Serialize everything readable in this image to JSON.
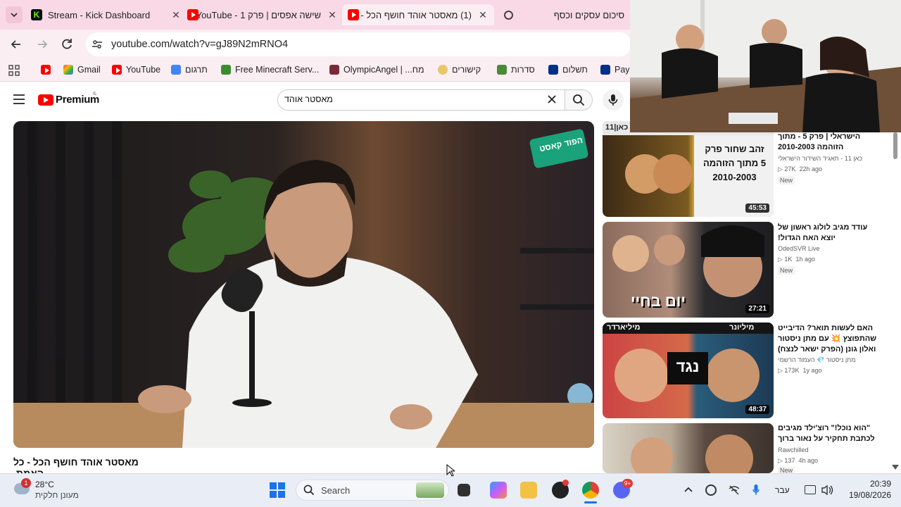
{
  "tabs": [
    {
      "title": "Stream - Kick Dashboard",
      "favicon": "kick-icon"
    },
    {
      "title": "שישה אפסים | פרק 1 - YouTube",
      "favicon": "youtube-icon"
    },
    {
      "title": "(1) מאסטר אוהד חושף הכל -",
      "favicon": "youtube-icon",
      "active": true
    },
    {
      "title": "סיכום עסקים וכסף",
      "favicon": "chatgpt-icon"
    }
  ],
  "address": {
    "url": "youtube.com/watch?v=gJ89N2mRNO4"
  },
  "bookmarks": [
    {
      "label": "",
      "icon": "youtube-icon"
    },
    {
      "label": "Gmail",
      "icon": "gmail-icon"
    },
    {
      "label": "YouTube",
      "icon": "youtube-icon"
    },
    {
      "label": "תרגום",
      "icon": "translate-icon"
    },
    {
      "label": "Free Minecraft Serv...",
      "icon": "minecraft-icon"
    },
    {
      "label": "OlympicAngel | ...מח",
      "icon": "bookmark-icon"
    },
    {
      "label": "קישורים",
      "icon": "bookmark-icon"
    },
    {
      "label": "סדרות",
      "icon": "bookmark-icon"
    },
    {
      "label": "תשלום",
      "icon": "paypal-icon"
    },
    {
      "label": "Payl",
      "icon": "paypal-icon"
    }
  ],
  "youtube": {
    "logo_text": "Premium",
    "country": "IL",
    "search_value": "מאסטר אוהד",
    "video_title": "מאסטר אוהד חושף הכל - כל האמת.",
    "player_badge": "הפוד קאסט"
  },
  "sidebar_videos": [
    {
      "title": "הישראלי | פרק 5 - מתוך הזוהמה 2010-2003",
      "channel": "כאן 11 - תאגיד השידור הישראלי",
      "views": "27K",
      "age": "22h ago",
      "badge": "New",
      "duration": "45:53",
      "thumb_text": "זהב שחור  פרק 5 מתוך הזוהמה 2010-2003",
      "corner": "כאן|11"
    },
    {
      "title": "עודד מגיב לולוג ראשון של יוצא האח הגדול!",
      "channel": "OdedSVR Live",
      "views": "1K",
      "age": "1h ago",
      "badge": "New",
      "duration": "27:21",
      "thumb_text": "יום בחיי"
    },
    {
      "title": "האם לעשות תואר? הדיבייט שהתפוצץ 💥 עם מתן ניסטור ואלון גונן (הפרק ישאר לנצח)",
      "channel": "מתן ניסטור 💎 העמוד הרשמי",
      "views": "173K",
      "age": "1y ago",
      "badge": "",
      "duration": "48:37",
      "thumb_text": "נגד",
      "corner_left": "מיליארדר",
      "corner_right": "מיליונר"
    },
    {
      "title": "\"הוא נוכל!\" רוצ'ילד מגיבים לכתבת תחקיר על נאור ברוך",
      "channel": "Rawchilled",
      "views": "137",
      "age": "4h ago",
      "badge": "New",
      "duration": ""
    }
  ],
  "taskbar": {
    "weather_temp": "28°C",
    "weather_desc": "מעונן חלקית",
    "weather_badge": "1",
    "search_label": "Search",
    "discord_badge": "9+",
    "lang": "עבר",
    "time": "20:39",
    "date": "19/08/2026"
  },
  "colors": {
    "accent": "#ff0000",
    "tabstrip": "#f9d9e6",
    "toolbar": "#fbeef3"
  }
}
